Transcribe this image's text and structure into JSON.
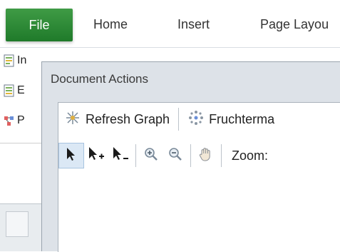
{
  "ribbon": {
    "tabs": [
      "File",
      "Home",
      "Insert",
      "Page Layou"
    ],
    "left_items": [
      "In",
      "E",
      "P"
    ]
  },
  "panel": {
    "title": "Document Actions",
    "toolbar": {
      "refresh_label": "Refresh Graph",
      "layout_label": "Fruchterma"
    },
    "zoom_label": "Zoom:"
  }
}
